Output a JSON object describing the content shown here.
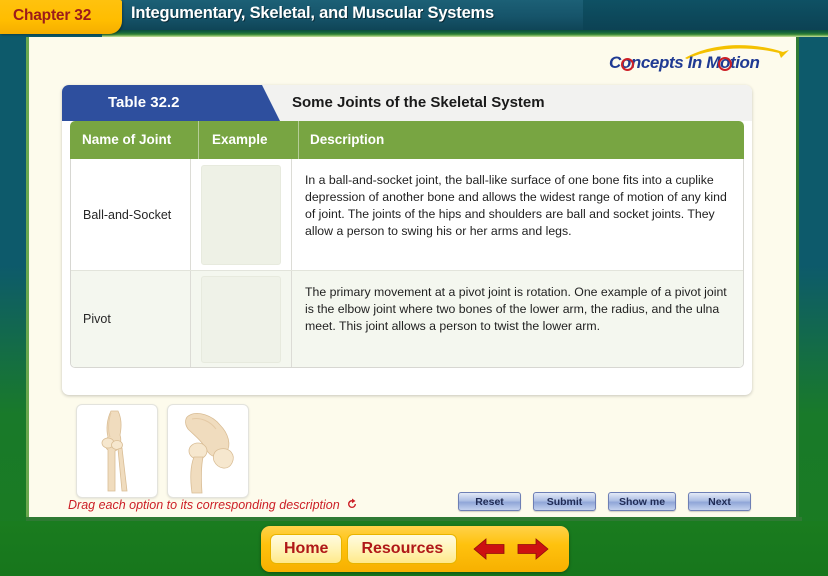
{
  "header": {
    "chapter_label": "Chapter 32",
    "title": "Integumentary, Skeletal, and Muscular Systems",
    "logo_text": "Concepts In Motion"
  },
  "table": {
    "number_label": "Table 32.2",
    "title": "Some Joints of the Skeletal System",
    "columns": [
      "Name of Joint",
      "Example",
      "Description"
    ],
    "rows": [
      {
        "name": "Ball-and-Socket",
        "example": "",
        "description": "In a ball-and-socket joint, the ball-like surface of one bone fits into a cuplike depression of another bone and allows the widest range of motion of any kind of joint. The joints of the hips and shoulders are ball and socket joints. They allow a person to swing his or her arms and legs."
      },
      {
        "name": "Pivot",
        "example": "",
        "description": "The primary movement at a pivot joint is rotation. One example of a pivot joint is the elbow joint where two bones of the lower arm, the radius, and the ulna meet. This joint allows a person to twist the lower arm."
      }
    ]
  },
  "options": [
    {
      "name": "elbow-joint-image"
    },
    {
      "name": "hip-joint-image"
    }
  ],
  "instruction": "Drag each option to its corresponding description",
  "actions": [
    {
      "label": "Reset"
    },
    {
      "label": "Submit"
    },
    {
      "label": "Show me"
    },
    {
      "label": "Next"
    }
  ],
  "bottom_nav": {
    "home_label": "Home",
    "resources_label": "Resources",
    "back_icon": "arrow-left-icon",
    "forward_icon": "arrow-right-icon"
  },
  "colors": {
    "header_blue": "#16546a",
    "chapter_yellow": "#ffc20e",
    "table_banner_blue": "#2e4f9e",
    "table_header_green": "#78a542",
    "instruction_red": "#cc2027",
    "nav_yellow": "#ffc20e",
    "footer_green": "#1a7c1f"
  }
}
